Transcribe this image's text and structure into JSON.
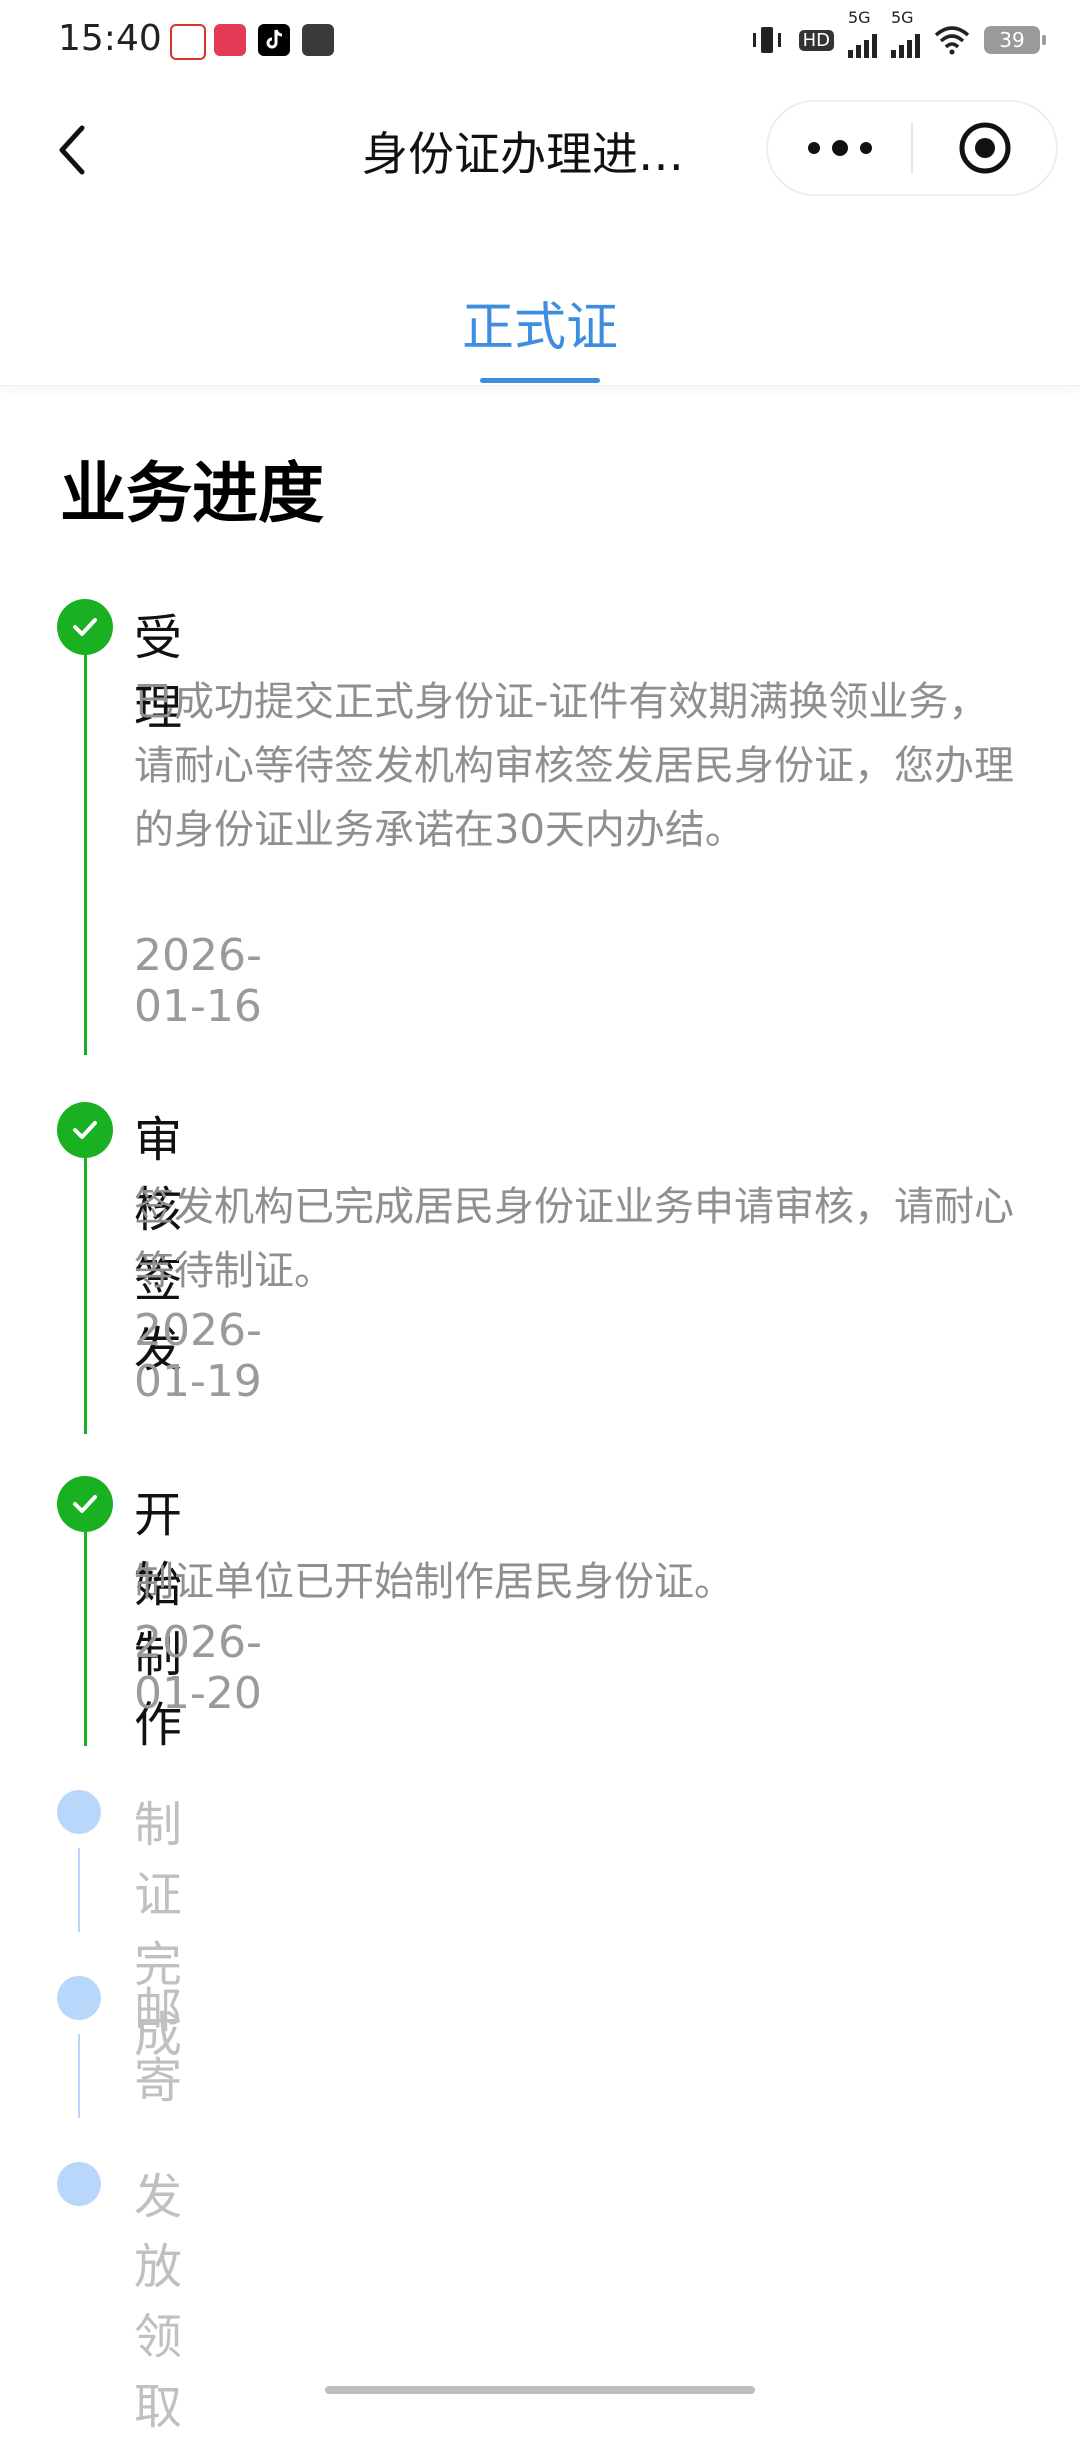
{
  "status_bar": {
    "time": "15:40",
    "battery": "39",
    "network": [
      "HD",
      "5G",
      "5G"
    ],
    "notification_colors": [
      "#d8352a",
      "#e33a55",
      "#000000",
      "#3a3a3a"
    ]
  },
  "nav": {
    "title": "身份证办理进…",
    "back_icon": "chevron-left-icon",
    "more_icon": "more-dots-icon",
    "close_icon": "target-circle-icon"
  },
  "tabs": [
    {
      "label": "正式证",
      "active": true
    }
  ],
  "section_title": "业务进度",
  "steps": [
    {
      "title": "受理",
      "desc": "已成功提交正式身份证-证件有效期满换领业务，请耐心等待签发机构审核签发居民身份证，您办理的身份证业务承诺在30天内办结。",
      "date": "2026-01-16",
      "status": "done"
    },
    {
      "title": "审核签发",
      "desc": "签发机构已完成居民身份证业务申请审核，请耐心等待制证。",
      "date": "2026-01-19",
      "status": "done"
    },
    {
      "title": "开始制作",
      "desc": "制证单位已开始制作居民身份证。",
      "date": "2026-01-20",
      "status": "done"
    },
    {
      "title": "制证完成",
      "status": "pending"
    },
    {
      "title": "邮寄",
      "status": "pending"
    },
    {
      "title": "发放领取",
      "status": "pending"
    }
  ],
  "colors": {
    "accent_blue": "#3d8ee0",
    "done_green": "#19b021",
    "pending_blue": "#b9d6fb",
    "muted_text": "#8f8f8f"
  }
}
